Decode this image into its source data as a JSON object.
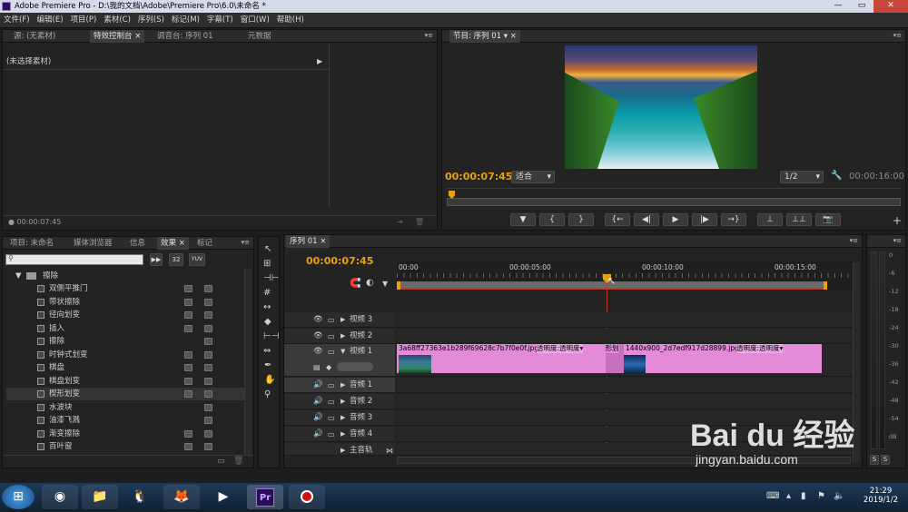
{
  "window": {
    "title": "Adobe Premiere Pro - D:\\我的文档\\Adobe\\Premiere Pro\\6.0\\未命名 *"
  },
  "menu": [
    "文件(F)",
    "编辑(E)",
    "项目(P)",
    "素材(C)",
    "序列(S)",
    "标记(M)",
    "字幕(T)",
    "窗口(W)",
    "帮助(H)"
  ],
  "source_panel": {
    "tabs": [
      "源: (无素材)",
      "特效控制台",
      "调音台: 序列 01",
      "元数据"
    ],
    "clip_label": "(未选择素材)",
    "timecode": "00:00:07:45"
  },
  "program_panel": {
    "tab": "节目: 序列 01",
    "timecode": "00:00:07:45",
    "fit": "适合",
    "ratio": "1/2",
    "duration": "00:00:16:00"
  },
  "project_panel": {
    "tabs": [
      "项目: 未命名",
      "媒体浏览器",
      "信息",
      "效果",
      "标记"
    ],
    "btn_32": "32",
    "btn_yuv": "YUV",
    "folder": "擦除",
    "items": [
      "双侧平推门",
      "带状擦除",
      "径向划变",
      "插入",
      "擦除",
      "时钟式划变",
      "棋盘",
      "棋盘划变",
      "楔形划变",
      "水波块",
      "油漆飞溅",
      "渐变擦除",
      "百叶窗"
    ]
  },
  "timeline": {
    "tab": "序列 01",
    "timecode": "00:00:07:45",
    "ruler": [
      "00:00",
      "00:00:05:00",
      "00:00:10:00",
      "00:00:15:00"
    ],
    "tracks": [
      {
        "name": "视频 3"
      },
      {
        "name": "视频 2"
      },
      {
        "name": "视频 1"
      },
      {
        "name": "音频 1"
      },
      {
        "name": "音频 2"
      },
      {
        "name": "音频 3"
      },
      {
        "name": "音频 4"
      },
      {
        "name": "主音轨"
      }
    ],
    "clips": {
      "clip1_name": "3a68ff27363e1b289f69628c7b7f0e0f.jpg",
      "clip1_fx": "透明度:透明度▾",
      "transition": "楔形划",
      "clip2_name": "1440x900_2d7edf917d28899.jpg",
      "clip2_fx": "透明度:透明度▾"
    }
  },
  "audio_meter": {
    "labels": [
      "0",
      "-6",
      "-12",
      "-18",
      "-24",
      "-30",
      "-36",
      "-42",
      "-48",
      "-54",
      "dB"
    ],
    "solo": "S"
  },
  "watermark": {
    "text": "Bai du 经验",
    "url": "jingyan.baidu.com"
  },
  "taskbar": {
    "time": "21:29",
    "date": "2019/1/2"
  }
}
